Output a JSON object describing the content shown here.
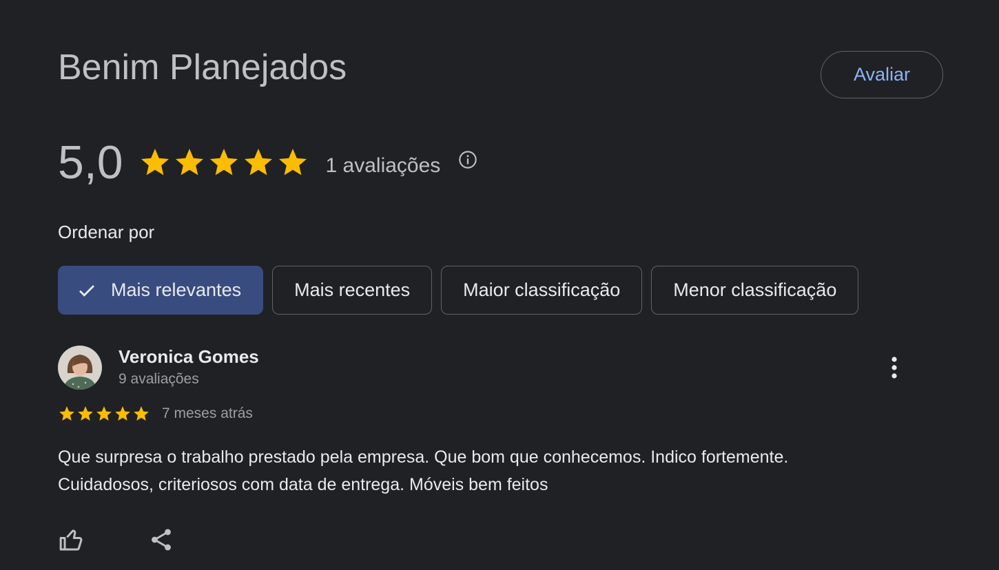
{
  "business": {
    "name": "Benim Planejados",
    "rate_label": "Avaliar"
  },
  "summary": {
    "rating": "5,0",
    "stars": 5,
    "review_count": "1 avaliações",
    "info_icon": "info-icon"
  },
  "sort": {
    "label": "Ordenar por",
    "options": [
      {
        "label": "Mais relevantes",
        "selected": true
      },
      {
        "label": "Mais recentes",
        "selected": false
      },
      {
        "label": "Maior classificação",
        "selected": false
      },
      {
        "label": "Menor classificação",
        "selected": false
      }
    ]
  },
  "review": {
    "author": "Veronica Gomes",
    "author_reviews": "9 avaliações",
    "stars": 5,
    "time": "7 meses atrás",
    "text_line1": "Que surpresa o trabalho prestado pela empresa. Que bom que conhecemos. Indico fortemente.",
    "text_line2": "Cuidadosos, criteriosos com data de entrega. Móveis bem feitos",
    "actions": [
      "thumbs-up-icon",
      "share-icon"
    ]
  },
  "colors": {
    "background": "#202124",
    "star": "#fbbc04",
    "accent": "#8ab4f8",
    "selected_chip": "#394c7f"
  }
}
